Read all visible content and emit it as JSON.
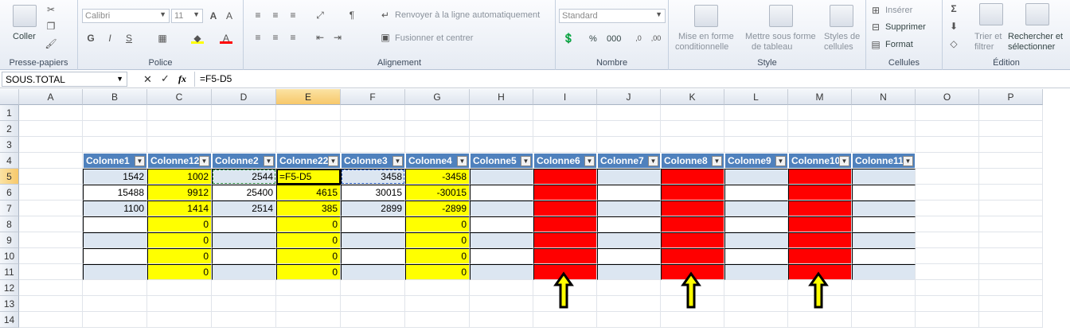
{
  "ribbon": {
    "clipboard": {
      "label": "Presse-papiers",
      "paste": "Coller"
    },
    "font": {
      "label": "Police",
      "name": "Calibri",
      "size": "11"
    },
    "alignment": {
      "label": "Alignement",
      "wrap": "Renvoyer à la ligne automatiquement",
      "merge": "Fusionner et centrer"
    },
    "number": {
      "label": "Nombre",
      "format": "Standard",
      "percent": "%",
      "thousands": "000"
    },
    "style": {
      "label": "Style",
      "cond_line1": "Mise en forme",
      "cond_line2": "conditionnelle",
      "table_line1": "Mettre sous forme",
      "table_line2": "de tableau",
      "cell_line1": "Styles de",
      "cell_line2": "cellules"
    },
    "cells": {
      "label": "Cellules",
      "insert": "Insérer",
      "delete": "Supprimer",
      "format": "Format"
    },
    "editing": {
      "label": "Édition",
      "sort_line1": "Trier et",
      "sort_line2": "filtrer",
      "find_line1": "Rechercher et",
      "find_line2": "sélectionner"
    }
  },
  "formula_bar": {
    "name_box": "SOUS.TOTAL",
    "formula": "=F5-D5",
    "fx": "fx"
  },
  "columns": [
    "A",
    "B",
    "C",
    "D",
    "E",
    "F",
    "G",
    "H",
    "I",
    "J",
    "K",
    "L",
    "M",
    "N",
    "O",
    "P"
  ],
  "rows": [
    "1",
    "2",
    "3",
    "4",
    "5",
    "6",
    "7",
    "8",
    "9",
    "10",
    "11",
    "12",
    "13",
    "14"
  ],
  "headers": [
    "Colonne1",
    "Colonne12",
    "Colonne2",
    "Colonne22",
    "Colonne3",
    "Colonne4",
    "Colonne5",
    "Colonne6",
    "Colonne7",
    "Colonne8",
    "Colonne9",
    "Colonne10",
    "Colonne11"
  ],
  "table": [
    [
      "1542",
      "1002",
      "2544",
      "=F5-D5",
      "3458",
      "-3458"
    ],
    [
      "15488",
      "9912",
      "25400",
      "4615",
      "30015",
      "-30015"
    ],
    [
      "1100",
      "1414",
      "2514",
      "385",
      "2899",
      "-2899"
    ],
    [
      "",
      "0",
      "",
      "0",
      "",
      "0"
    ],
    [
      "",
      "0",
      "",
      "0",
      "",
      "0"
    ],
    [
      "",
      "0",
      "",
      "0",
      "",
      "0"
    ],
    [
      "",
      "0",
      "",
      "0",
      "",
      "0"
    ]
  ],
  "colors": {
    "header_blue": "#4f81bd",
    "band": "#dce6f1",
    "yellow": "#ffff00",
    "red": "#ff0000",
    "arrow_fill": "#ffff00"
  }
}
